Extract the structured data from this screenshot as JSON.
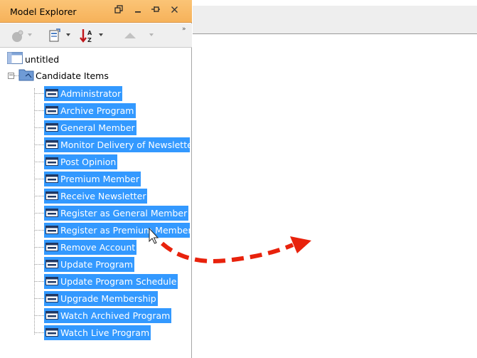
{
  "panel": {
    "title": "Model Explorer",
    "window_buttons": [
      "restore",
      "minimize",
      "pin",
      "close"
    ]
  },
  "toolbar": {
    "buttons": [
      {
        "icon": "new-model-icon",
        "dropdown": true,
        "enabled": false
      },
      {
        "icon": "view-options-icon",
        "dropdown": true,
        "enabled": true
      },
      {
        "icon": "sort-icon",
        "dropdown": true,
        "enabled": true
      },
      {
        "icon": "up-icon",
        "dropdown": true,
        "enabled": false
      }
    ],
    "overflow": "»"
  },
  "tree": {
    "root": {
      "label": "untitled",
      "icon": "project-icon"
    },
    "model": {
      "label": "Candidate Items",
      "icon": "model-folder-icon",
      "expanded": true
    },
    "items": [
      {
        "label": "Administrator"
      },
      {
        "label": "Archive Program"
      },
      {
        "label": "General Member"
      },
      {
        "label": "Monitor Delivery of Newslette"
      },
      {
        "label": "Post Opinion"
      },
      {
        "label": "Premium Member"
      },
      {
        "label": "Receive Newsletter"
      },
      {
        "label": "Register as General Member"
      },
      {
        "label": "Register as Premium Member"
      },
      {
        "label": "Remove Account"
      },
      {
        "label": "Update Program"
      },
      {
        "label": "Update Program Schedule"
      },
      {
        "label": "Upgrade Membership"
      },
      {
        "label": "Watch Archived Program"
      },
      {
        "label": "Watch Live Program"
      }
    ],
    "item_icon": "element-icon",
    "selection_color": "#3399ff"
  },
  "annotation": {
    "type": "drag-arrow",
    "color": "#e8220c",
    "style": "dashed"
  },
  "colors": {
    "title_bar": "#f6b25a",
    "toolbar_bg": "#efefef",
    "tabstrip_bg": "#eeeeee"
  }
}
